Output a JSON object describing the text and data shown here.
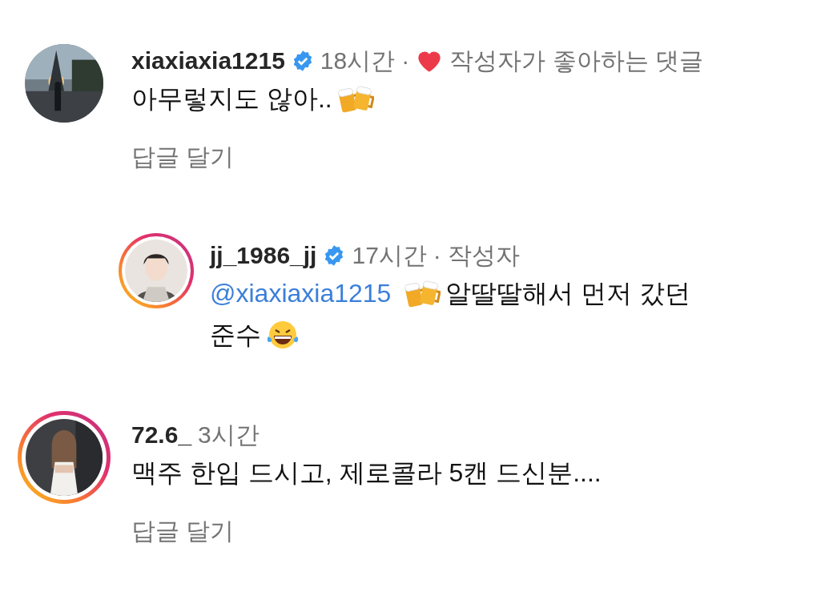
{
  "comments": [
    {
      "username": "xiaxiaxia1215",
      "verified": true,
      "time": "18시간",
      "separator": "·",
      "author_like": "작성자가 좋아하는 댓글",
      "story_ring": false,
      "reply": false,
      "lines": [
        [
          {
            "kind": "text",
            "text": "아무렇지도 않아.."
          },
          {
            "kind": "beer"
          }
        ]
      ],
      "reply_link": "답글 달기"
    },
    {
      "username": "jj_1986_jj",
      "verified": true,
      "time": "17시간",
      "separator": "·",
      "author_badge": "작성자",
      "story_ring": true,
      "reply": true,
      "lines": [
        [
          {
            "kind": "mention",
            "text": "@xiaxiaxia1215"
          },
          {
            "kind": "beer"
          },
          {
            "kind": "text",
            "text": "알딸딸해서 먼저 갔던"
          }
        ],
        [
          {
            "kind": "text",
            "text": "준수"
          },
          {
            "kind": "laugh"
          }
        ]
      ]
    },
    {
      "username": "72.6_",
      "verified": false,
      "time": "3시간",
      "story_ring": true,
      "reply": false,
      "lines": [
        [
          {
            "kind": "text",
            "text": "맥주 한입 드시고, 제로콜라 5캔 드신분...."
          }
        ]
      ],
      "reply_link": "답글 달기"
    }
  ]
}
